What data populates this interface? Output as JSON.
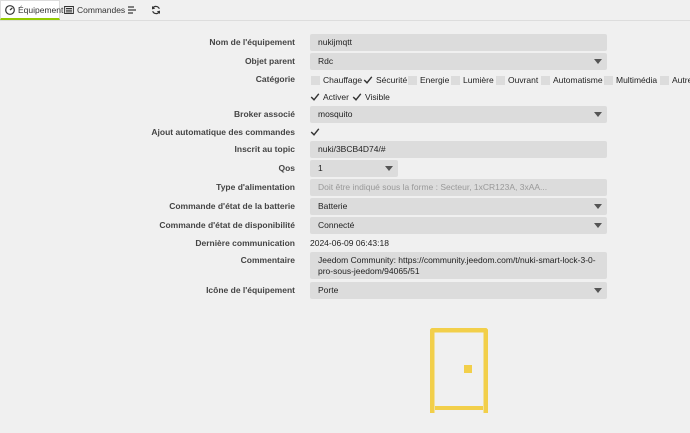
{
  "tabs": [
    {
      "label": "Équipement",
      "icon": "tachometer-icon"
    },
    {
      "label": "Commandes",
      "icon": "list-icon"
    },
    {
      "label": "",
      "icon": "menu-icon"
    },
    {
      "label": "",
      "icon": "refresh-icon"
    }
  ],
  "form": {
    "name": {
      "label": "Nom de l'équipement",
      "value": "nukijmqtt"
    },
    "parent": {
      "label": "Objet parent",
      "value": "Rdc"
    },
    "category": {
      "label": "Catégorie",
      "items": [
        {
          "label": "Chauffage",
          "checked": false
        },
        {
          "label": "Sécurité",
          "checked": true
        },
        {
          "label": "Energie",
          "checked": false
        },
        {
          "label": "Lumière",
          "checked": false
        },
        {
          "label": "Ouvrant",
          "checked": false
        },
        {
          "label": "Automatisme",
          "checked": false
        },
        {
          "label": "Multimédia",
          "checked": false
        },
        {
          "label": "Autre",
          "checked": false
        }
      ]
    },
    "flags": [
      {
        "label": "Activer",
        "checked": true
      },
      {
        "label": "Visible",
        "checked": true
      }
    ],
    "broker": {
      "label": "Broker associé",
      "value": "mosquito"
    },
    "auto_add": {
      "label": "Ajout automatique des commandes",
      "checked": true
    },
    "topic": {
      "label": "Inscrit au topic",
      "value": "nuki/3BCB4D74/#"
    },
    "qos": {
      "label": "Qos",
      "value": "1"
    },
    "power": {
      "label": "Type d'alimentation",
      "placeholder": "Doit être indiqué sous la forme : Secteur, 1xCR123A, 3xAA..."
    },
    "battery_cmd": {
      "label": "Commande d'état de la batterie",
      "value": "Batterie"
    },
    "availability_cmd": {
      "label": "Commande d'état de disponibilité",
      "value": "Connecté"
    },
    "last_comm": {
      "label": "Dernière communication",
      "value": "2024-06-09 06:43:18"
    },
    "comment": {
      "label": "Commentaire",
      "value": "Jeedom Community: https://community.jeedom.com/t/nuki-smart-lock-3-0-pro-sous-jeedom/94065/51"
    },
    "icon_select": {
      "label": "Icône de l'équipement",
      "value": "Porte"
    }
  },
  "preview_icon": {
    "name": "door-icon",
    "color": "#f2cf4a"
  },
  "accent_color": "#94ca02"
}
